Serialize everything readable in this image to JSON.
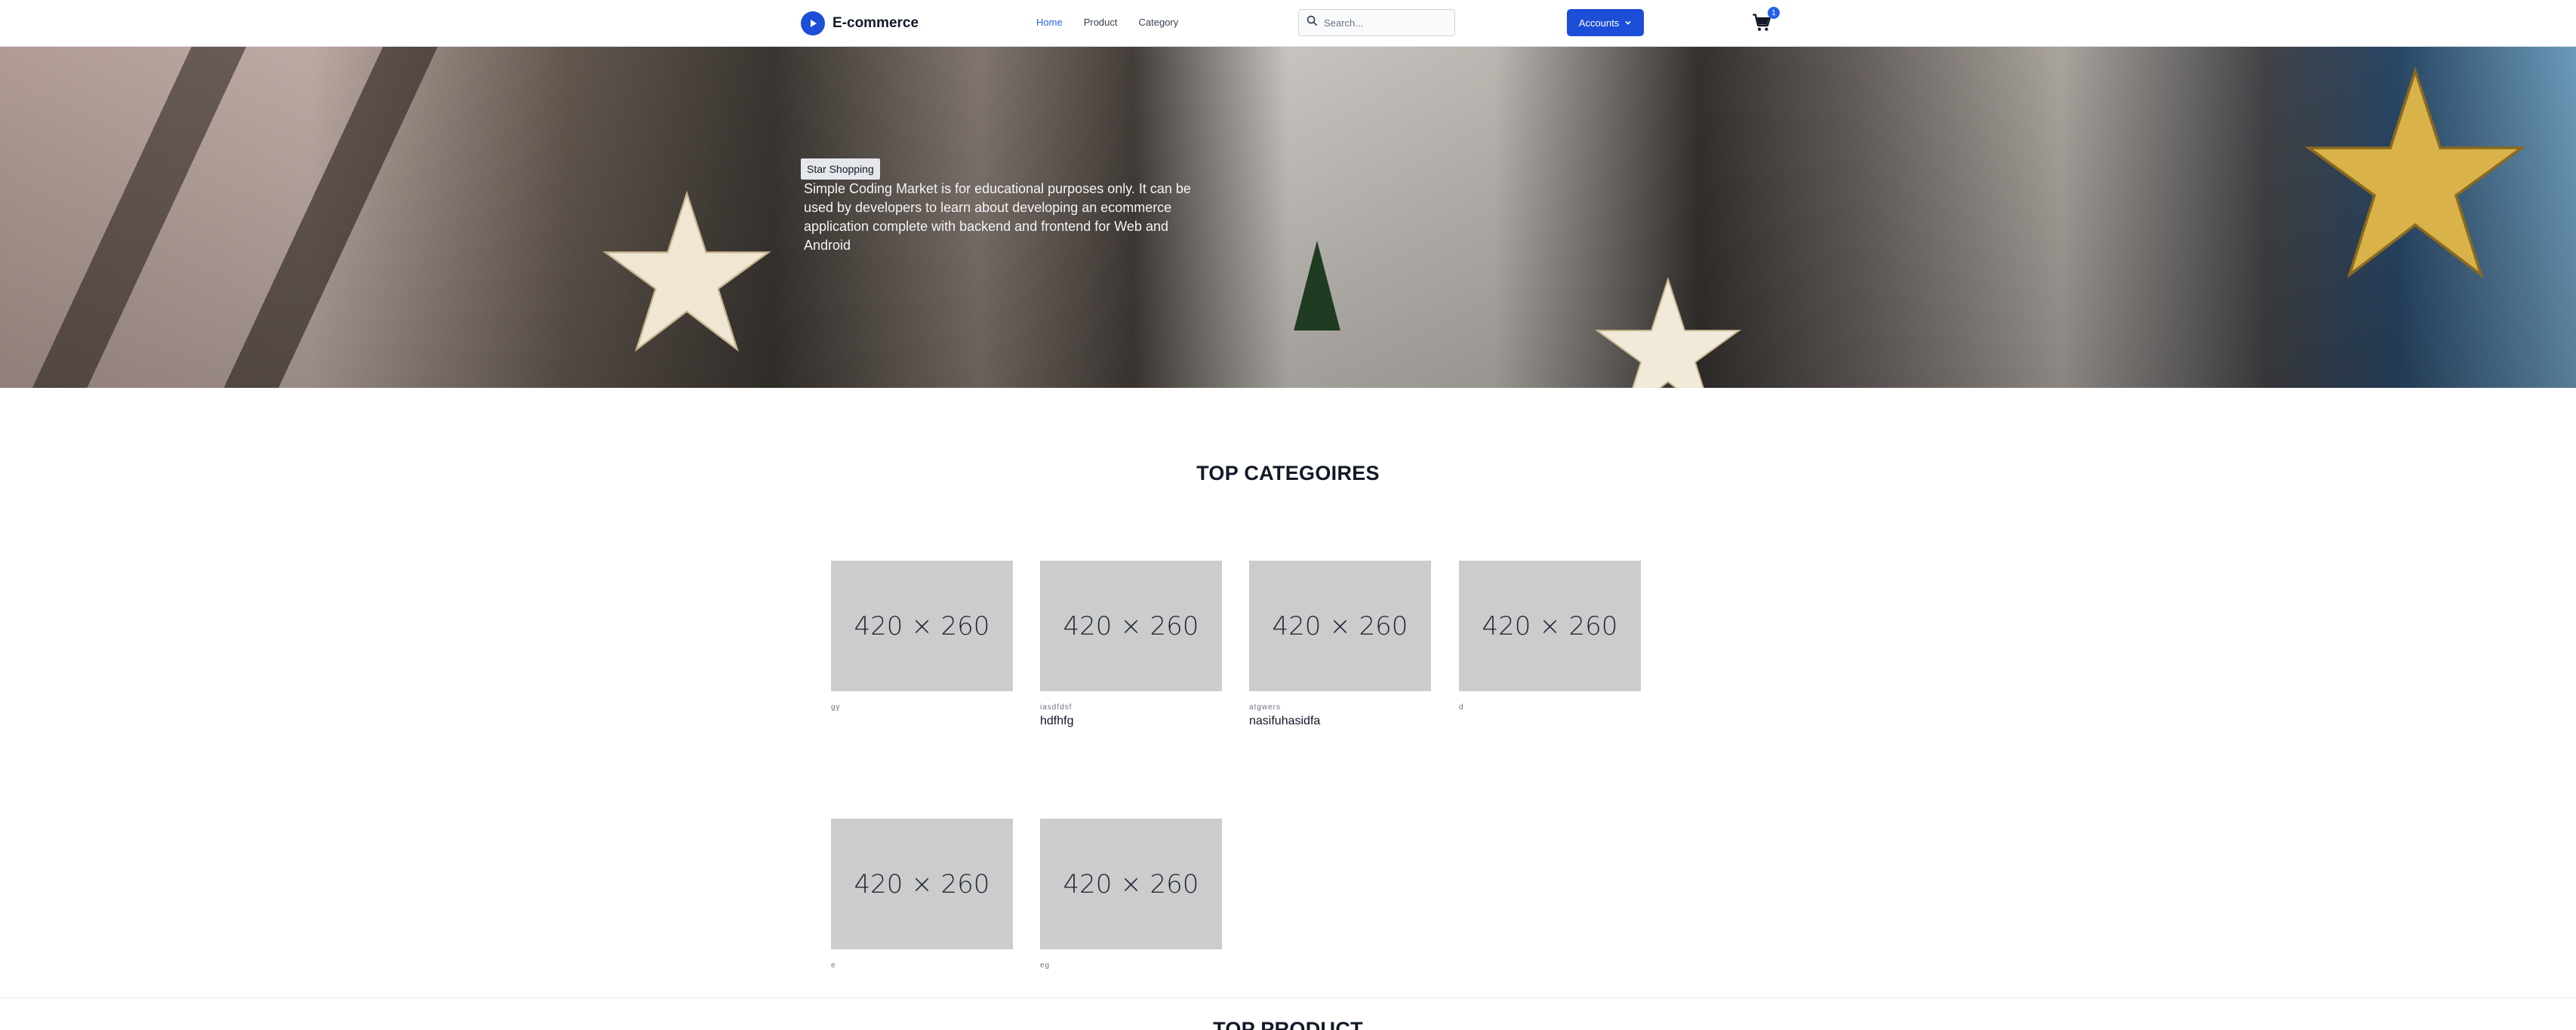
{
  "header": {
    "brand": "E-commerce",
    "nav": [
      "Home",
      "Product",
      "Category"
    ],
    "search_placeholder": "Search...",
    "accounts_label": "Accounts",
    "cart_count": "1"
  },
  "hero": {
    "tag": "Star Shopping",
    "description": "Simple Coding Market is for educational purposes only. It can be used by developers to learn about developing an ecommerce application complete with backend and frontend for Web and Android"
  },
  "categories": {
    "title": "TOP CATEGOIRES",
    "image_placeholder": "420 × 260",
    "items": [
      {
        "sub": "gy",
        "name": ""
      },
      {
        "sub": "iasdfdsf",
        "name": "hdfhfg"
      },
      {
        "sub": "atgwers",
        "name": "nasifuhasidfa"
      },
      {
        "sub": "d",
        "name": ""
      },
      {
        "sub": "e",
        "name": ""
      },
      {
        "sub": "eg",
        "name": ""
      }
    ]
  },
  "products": {
    "title": "TOP PRODUCT"
  },
  "colors": {
    "primary": "#1d4ed8",
    "link_active": "#2563eb",
    "placeholder_bg": "#cccccc"
  }
}
